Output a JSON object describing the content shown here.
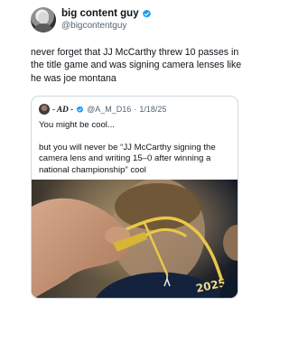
{
  "post": {
    "author": {
      "display_name": "big content guy",
      "handle": "@bigcontentguy"
    },
    "text": "never forget that JJ McCarthy threw 10 passes in the title game and was signing camera lenses like he was joe montana",
    "quote": {
      "display_name": "- AD -",
      "handle": "@A_M_D16",
      "separator": "·",
      "date": "1/18/25",
      "line1": "You might be cool...",
      "line2": "but you will never be “JJ McCarthy signing the camera lens and writing 15–0 after winning a national championship” cool",
      "media": {
        "jersey_number": "2025",
        "description_icon": "camera-lens-signing-photo"
      }
    }
  },
  "colors": {
    "text_primary": "#0f1419",
    "text_secondary": "#536471",
    "verified_blue": "#1d9bf0",
    "border": "#cfd9de",
    "marker_yellow": "#e9c84a"
  }
}
